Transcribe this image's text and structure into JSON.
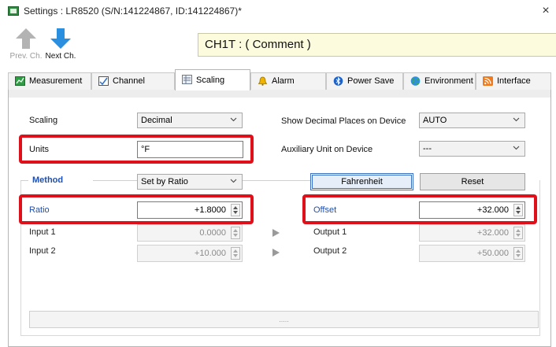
{
  "window": {
    "title": "Settings : LR8520 (S/N:141224867, ID:141224867)*",
    "close_label": "×"
  },
  "toolbar": {
    "prev_label": "Prev. Ch.",
    "next_label": "Next Ch.",
    "channel_comment": "CH1T : ( Comment )"
  },
  "tabs": [
    {
      "label": "Measurement",
      "icon": "measurement-icon"
    },
    {
      "label": "Channel",
      "icon": "channel-icon"
    },
    {
      "label": "Scaling",
      "icon": "scaling-icon",
      "active": true
    },
    {
      "label": "Alarm",
      "icon": "bell-icon"
    },
    {
      "label": "Power Save",
      "icon": "bluetooth-icon"
    },
    {
      "label": "Environment",
      "icon": "globe-icon"
    },
    {
      "label": "Interface",
      "icon": "interface-icon"
    }
  ],
  "scaling": {
    "scaling_label": "Scaling",
    "scaling_value": "Decimal",
    "units_label": "Units",
    "units_value": "°F",
    "show_decimal_label": "Show Decimal Places on Device",
    "show_decimal_value": "AUTO",
    "aux_unit_label": "Auxiliary Unit on Device",
    "aux_unit_value": "---"
  },
  "method": {
    "label": "Method",
    "value": "Set by Ratio",
    "fahrenheit_button": "Fahrenheit",
    "reset_button": "Reset",
    "ratio_label": "Ratio",
    "ratio_value": "+1.8000",
    "offset_label": "Offset",
    "offset_value": "+32.000",
    "input1_label": "Input 1",
    "input1_value": "0.0000",
    "input2_label": "Input 2",
    "input2_value": "+10.000",
    "output1_label": "Output 1",
    "output1_value": "+32.000",
    "output2_label": "Output 2",
    "output2_value": "+50.000"
  },
  "bottom_bar": {
    "text": "....."
  },
  "colors": {
    "highlight": "#e0101a",
    "label_blue": "#1f4fae",
    "comment_bg": "#fdfbde"
  }
}
